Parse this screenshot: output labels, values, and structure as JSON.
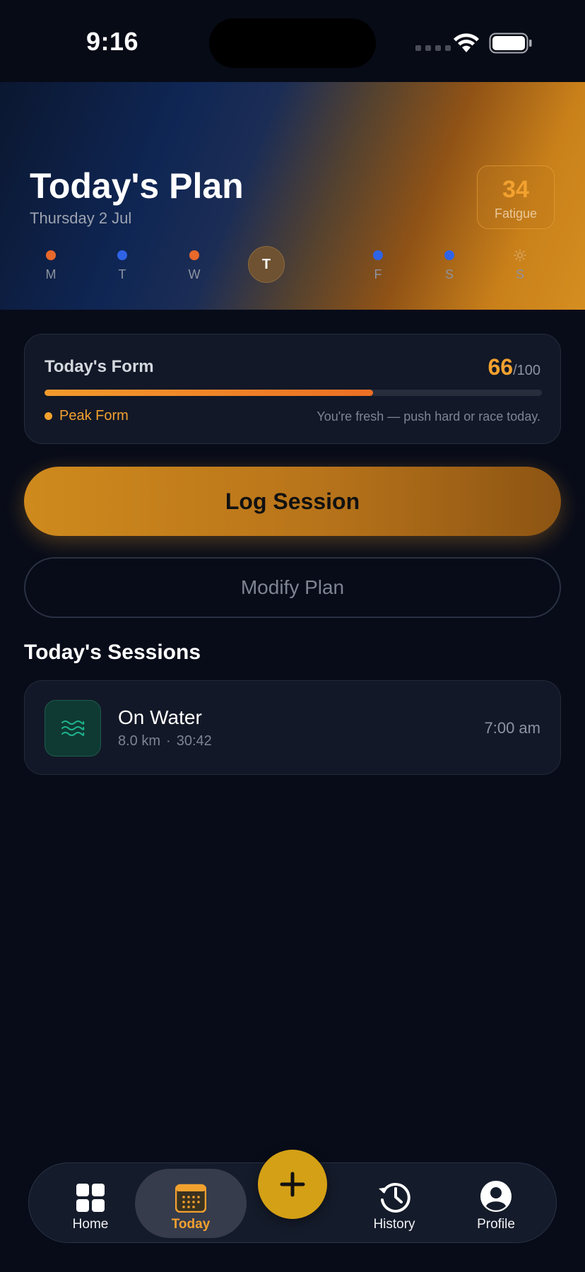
{
  "status_bar": {
    "time": "9:16"
  },
  "hero": {
    "title": "Today's Plan",
    "date": "Thursday 2 Jul",
    "fatigue": {
      "value": "34",
      "label": "Fatigue"
    },
    "week": [
      {
        "label": "M",
        "type": "orange"
      },
      {
        "label": "T",
        "type": "blue"
      },
      {
        "label": "W",
        "type": "orange"
      },
      {
        "label": "T",
        "type": "today"
      },
      {
        "label": "F",
        "type": "blue"
      },
      {
        "label": "S",
        "type": "blue"
      },
      {
        "label": "S",
        "type": "rest"
      }
    ]
  },
  "form": {
    "title": "Today's Form",
    "score": "66",
    "score_max": "/100",
    "progress": 0.66,
    "status": "Peak Form",
    "hint": "You're fresh — push hard or race today."
  },
  "actions": {
    "log_session": "Log Session",
    "modify_plan": "Modify Plan"
  },
  "sessions": {
    "heading": "Today's Sessions",
    "items": [
      {
        "title": "On Water",
        "distance": "8.0 km",
        "separator": "·",
        "duration": "30:42",
        "time": "7:00 am",
        "icon": "waves-icon"
      }
    ]
  },
  "tab_bar": {
    "items": [
      {
        "label": "Home",
        "icon": "grid-icon"
      },
      {
        "label": "Today",
        "icon": "calendar-icon",
        "active": true
      },
      {
        "label": "History",
        "icon": "history-icon"
      },
      {
        "label": "Profile",
        "icon": "profile-icon"
      }
    ],
    "fab_icon": "plus-icon"
  },
  "colors": {
    "accent": "#f2a12f",
    "background": "#080c19",
    "card": "#121827",
    "orange_dot": "#e8692a",
    "blue_dot": "#2f63e6",
    "water_green": "#1fb58f"
  }
}
